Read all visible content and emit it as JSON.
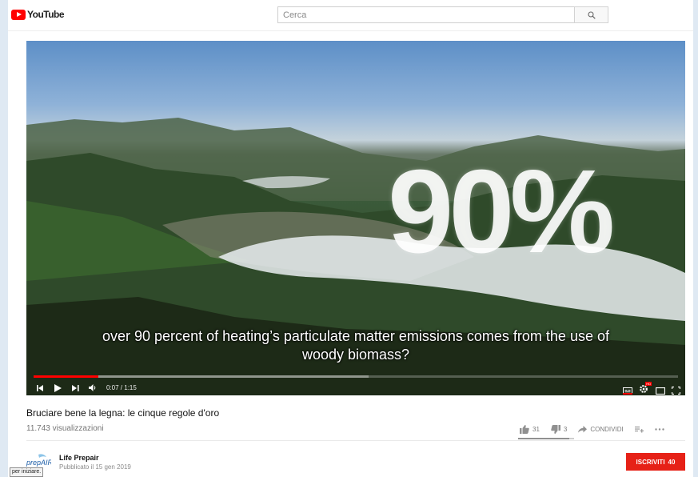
{
  "brand": {
    "name": "YouTube",
    "color": "#ff0000"
  },
  "search": {
    "placeholder": "Cerca"
  },
  "video": {
    "overlay_text": "90%",
    "subtitle_line1": "over 90 percent of heating’s particulate matter emissions comes from the use of",
    "subtitle_line2": "woody biomass?",
    "time_display": "0:07 / 1:15",
    "progress_played": 0.1,
    "progress_buffered": 0.52
  },
  "info": {
    "title": "Bruciare bene la legna: le cinque regole d'oro",
    "views": "11.743 visualizzazioni",
    "likes": "31",
    "dislikes": "3",
    "share_label": "CONDIVIDI",
    "like_ratio": 0.91
  },
  "channel": {
    "logo_text": "prepAIR",
    "name": "Life Prepair",
    "published": "Pubblicato il 15 gen 2019",
    "subscribe_label": "ISCRIVITI",
    "subscriber_count": "40"
  },
  "tooltip": {
    "text": "per iniziare."
  },
  "colors": {
    "subscribe": "#e62117",
    "progress": "#ff0000"
  }
}
